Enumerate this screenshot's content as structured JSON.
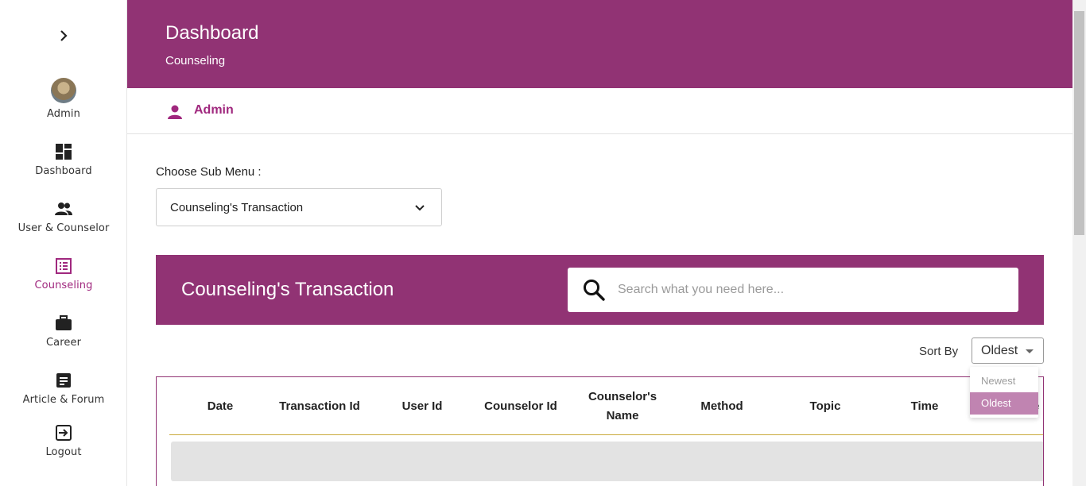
{
  "sidebar": {
    "toggle_icon": "chevron-right-icon",
    "items": [
      {
        "label": "Admin",
        "icon": "avatar"
      },
      {
        "label": "Dashboard",
        "icon": "dashboard-icon"
      },
      {
        "label": "User & Counselor",
        "icon": "people-icon"
      },
      {
        "label": "Counseling",
        "icon": "list-icon",
        "active": true
      },
      {
        "label": "Career",
        "icon": "briefcase-icon"
      },
      {
        "label": "Article & Forum",
        "icon": "article-icon"
      },
      {
        "label": "Logout",
        "icon": "logout-icon"
      }
    ]
  },
  "header": {
    "title": "Dashboard",
    "subtitle": "Counseling"
  },
  "userbar": {
    "name": "Admin",
    "icon": "person-icon"
  },
  "submenu": {
    "label": "Choose Sub Menu :",
    "selected": "Counseling's Transaction"
  },
  "banner": {
    "title": "Counseling's Transaction",
    "search_placeholder": "Search what you need here..."
  },
  "sort": {
    "label": "Sort By",
    "selected": "Oldest",
    "options": [
      "Newest",
      "Oldest"
    ]
  },
  "table": {
    "columns": [
      "Date",
      "Transaction Id",
      "User Id",
      "Counselor Id",
      "Counselor's Name",
      "Method",
      "Topic",
      "Time",
      "Price"
    ]
  },
  "colors": {
    "primary": "#913374",
    "accent": "#a0287e",
    "dropdown_selected": "#c084b1"
  }
}
